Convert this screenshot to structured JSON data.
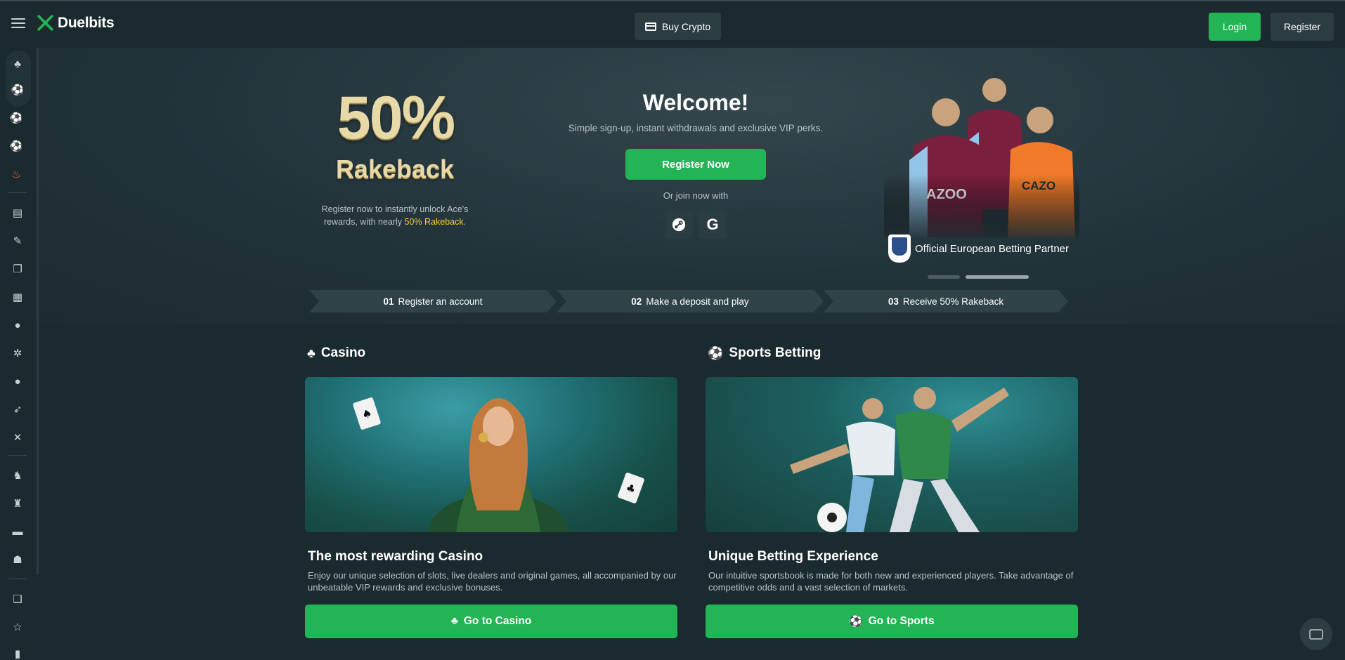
{
  "header": {
    "logo_text": "Duelbits",
    "buy_crypto_label": "Buy Crypto",
    "login_label": "Login",
    "register_label": "Register"
  },
  "sidebar": {
    "icons": [
      "casino-icon",
      "sports-icon",
      "live-sports-icon",
      "football-icon",
      "hot-icon",
      "arcade-icon",
      "originals-icon",
      "slots-icon",
      "table-games-icon",
      "roulette-icon",
      "wheel-icon",
      "mines-icon",
      "crash-icon",
      "battles-icon",
      "racing-icon",
      "horse-icon",
      "lottery-icon",
      "esports-icon",
      "gift-icon",
      "star-icon",
      "leaderboard-icon"
    ]
  },
  "hero": {
    "percent": "50%",
    "rakeback": "Rakeback",
    "desc_main": "Register now to instantly unlock Ace's rewards, with nearly ",
    "desc_highlight": "50% Rakeback",
    "desc_end": ".",
    "welcome": "Welcome!",
    "welcome_sub": "Simple sign-up, instant withdrawals and exclusive VIP perks.",
    "register_now": "Register Now",
    "join_with": "Or join now with",
    "google_glyph": "G",
    "partner_text": "Official European Betting Partner",
    "carousel_slide": 2,
    "carousel_total": 2
  },
  "steps": [
    {
      "num": "01",
      "label": "Register an account"
    },
    {
      "num": "02",
      "label": "Make a deposit and play"
    },
    {
      "num": "03",
      "label": "Receive 50% Rakeback"
    }
  ],
  "casino": {
    "heading": "Casino",
    "title": "The most rewarding Casino",
    "desc": "Enjoy our unique selection of slots, live dealers and original games, all accompanied by our unbeatable VIP rewards and exclusive bonuses.",
    "button": "Go to Casino"
  },
  "sports": {
    "heading": "Sports Betting",
    "title": "Unique Betting Experience",
    "desc": "Our intuitive sportsbook is made for both new and experienced players. Take advantage of competitive odds and a vast selection of markets.",
    "button": "Go to Sports"
  },
  "colors": {
    "accent_green": "#22b455",
    "highlight_yellow": "#f5cc2c",
    "gold_text": "#e8d9a8",
    "background": "#1a2a2e"
  }
}
